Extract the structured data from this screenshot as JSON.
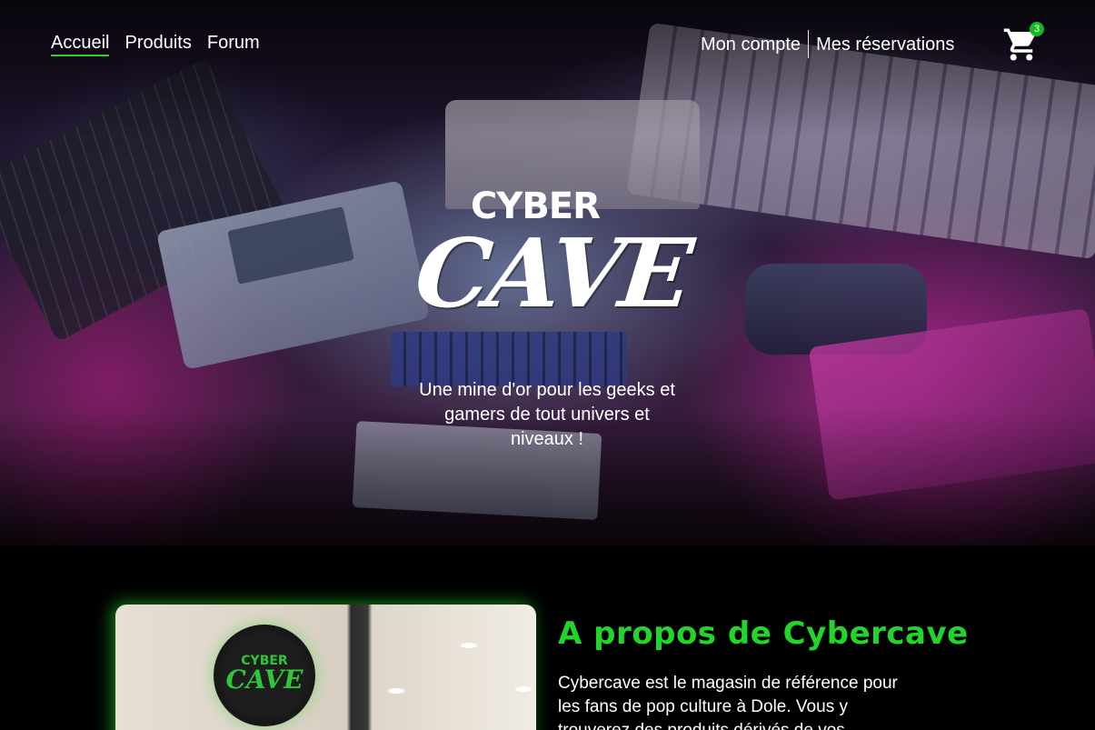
{
  "nav": {
    "left": [
      {
        "label": "Accueil",
        "active": true
      },
      {
        "label": "Produits",
        "active": false
      },
      {
        "label": "Forum",
        "active": false
      }
    ],
    "account_label": "Mon compte",
    "reservations_label": "Mes réservations",
    "cart_count": "3",
    "cart_icon": "shopping-cart-icon"
  },
  "hero": {
    "logo_top": "CYBER",
    "logo_main": "CAVE",
    "tagline": "Une mine d'or pour les geeks et gamers de tout univers et niveaux !"
  },
  "about": {
    "title": "A propos de Cybercave",
    "text": "Cybercave est le magasin de référence pour les fans de pop culture à Dole. Vous y trouverez des produits dérivés de vos",
    "image_sign_top": "CYBER",
    "image_sign_main": "CAVE"
  },
  "colors": {
    "accent": "#23d52a",
    "background": "#000000",
    "badge": "#14b81f"
  }
}
